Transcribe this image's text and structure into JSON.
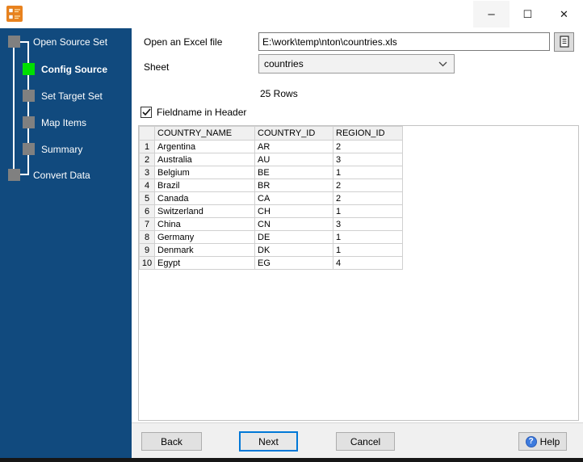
{
  "titlebar": {
    "minimize_glyph": "–",
    "maximize_glyph": "☐",
    "close_glyph": "✕"
  },
  "sidebar": {
    "steps": [
      {
        "label": "Open Source Set",
        "active": false
      },
      {
        "label": "Config Source",
        "active": true
      },
      {
        "label": "Set Target Set",
        "active": false
      },
      {
        "label": "Map Items",
        "active": false
      },
      {
        "label": "Summary",
        "active": false
      },
      {
        "label": "Convert Data",
        "active": false
      }
    ]
  },
  "form": {
    "file_label": "Open an Excel file",
    "file_path": "E:\\work\\temp\\nton\\countries.xls",
    "sheet_label": "Sheet",
    "sheet_value": "countries",
    "rows_info": "25 Rows",
    "header_checkbox_label": "Fieldname in Header",
    "header_checkbox_checked": true
  },
  "table": {
    "columns": [
      "COUNTRY_NAME",
      "COUNTRY_ID",
      "REGION_ID"
    ],
    "rows": [
      {
        "num": "1",
        "name": "Argentina",
        "id": "AR",
        "region": "2"
      },
      {
        "num": "2",
        "name": "Australia",
        "id": "AU",
        "region": "3"
      },
      {
        "num": "3",
        "name": "Belgium",
        "id": "BE",
        "region": "1"
      },
      {
        "num": "4",
        "name": "Brazil",
        "id": "BR",
        "region": "2"
      },
      {
        "num": "5",
        "name": "Canada",
        "id": "CA",
        "region": "2"
      },
      {
        "num": "6",
        "name": "Switzerland",
        "id": "CH",
        "region": "1"
      },
      {
        "num": "7",
        "name": "China",
        "id": "CN",
        "region": "3"
      },
      {
        "num": "8",
        "name": "Germany",
        "id": "DE",
        "region": "1"
      },
      {
        "num": "9",
        "name": "Denmark",
        "id": "DK",
        "region": "1"
      },
      {
        "num": "10",
        "name": "Egypt",
        "id": "EG",
        "region": "4"
      }
    ]
  },
  "footer": {
    "back_label": "Back",
    "next_label": "Next",
    "cancel_label": "Cancel",
    "help_label": "Help",
    "help_icon_glyph": "?"
  },
  "colors": {
    "sidebar_bg": "#114A7E",
    "active_step_green": "#00DF00",
    "step_gray": "#808080",
    "default_button_border": "#0078D7",
    "help_icon_blue": "#3D7BDE",
    "app_icon_orange": "#E8821E"
  }
}
